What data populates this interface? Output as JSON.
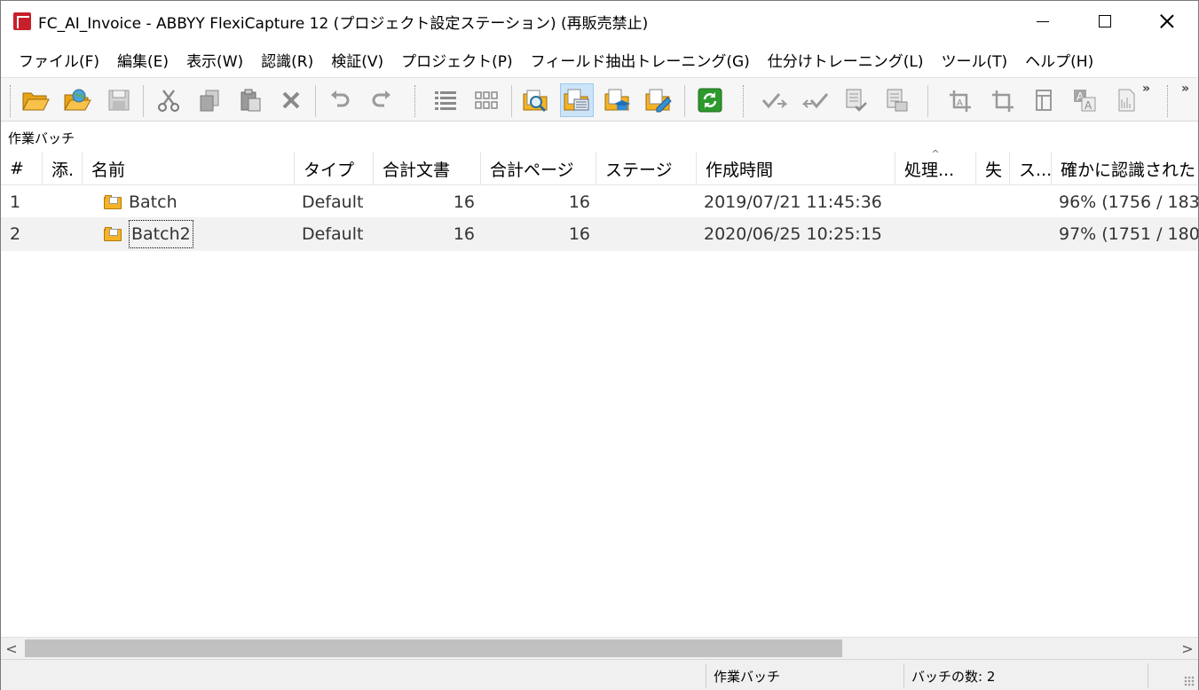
{
  "window": {
    "title": "FC_AI_Invoice - ABBYY FlexiCapture 12 (プロジェクト設定ステーション) (再販売禁止)"
  },
  "menu": [
    "ファイル(F)",
    "編集(E)",
    "表示(W)",
    "認識(R)",
    "検証(V)",
    "プロジェクト(P)",
    "フィールド抽出トレーニング(G)",
    "仕分けトレーニング(L)",
    "ツール(T)",
    "ヘルプ(H)"
  ],
  "toolbar": {
    "buttons": [
      {
        "name": "open-folder-icon"
      },
      {
        "name": "open-project-globe-icon"
      },
      {
        "name": "save-icon"
      },
      {
        "name": "cut-icon"
      },
      {
        "name": "copy-icon"
      },
      {
        "name": "paste-icon"
      },
      {
        "name": "delete-icon"
      },
      {
        "name": "undo-icon"
      },
      {
        "name": "redo-icon"
      },
      {
        "name": "details-view-icon"
      },
      {
        "name": "thumbnails-view-icon"
      },
      {
        "name": "batch-search-icon"
      },
      {
        "name": "batch-view-icon",
        "active": true
      },
      {
        "name": "training-batch-icon"
      },
      {
        "name": "batch-edit-icon"
      },
      {
        "name": "refresh-icon"
      },
      {
        "name": "verify-icon"
      },
      {
        "name": "verify-back-icon"
      },
      {
        "name": "document-check-icon"
      },
      {
        "name": "document-list-icon"
      },
      {
        "name": "crop-region-icon"
      },
      {
        "name": "crop-icon"
      },
      {
        "name": "table-region-icon"
      },
      {
        "name": "text-region-icon"
      },
      {
        "name": "barcode-region-icon"
      }
    ],
    "overflow_label": "»"
  },
  "pane": {
    "label": "作業バッチ"
  },
  "table": {
    "columns": [
      "#",
      "添.",
      "名前",
      "タイプ",
      "合計文書",
      "合計ページ",
      "ステージ",
      "作成時間",
      "処理...",
      "失",
      "ス...",
      "確かに認識された"
    ],
    "rows": [
      {
        "index": "1",
        "attach": "",
        "name": "Batch",
        "type": "Default",
        "docs": "16",
        "pages": "16",
        "stage": "",
        "created": "2019/07/21 11:45:36",
        "processing": "",
        "failed": "",
        "status": "",
        "confident": "96% (1756 / 183"
      },
      {
        "index": "2",
        "attach": "",
        "name": "Batch2",
        "type": "Default",
        "docs": "16",
        "pages": "16",
        "stage": "",
        "created": "2020/06/25 10:25:15",
        "processing": "",
        "failed": "",
        "status": "",
        "confident": "97% (1751 / 180"
      }
    ]
  },
  "scrollbar": {
    "left_arrow": "<",
    "right_arrow": ">"
  },
  "statusbar": {
    "view_label": "作業バッチ",
    "batch_count": "バッチの数: 2"
  }
}
